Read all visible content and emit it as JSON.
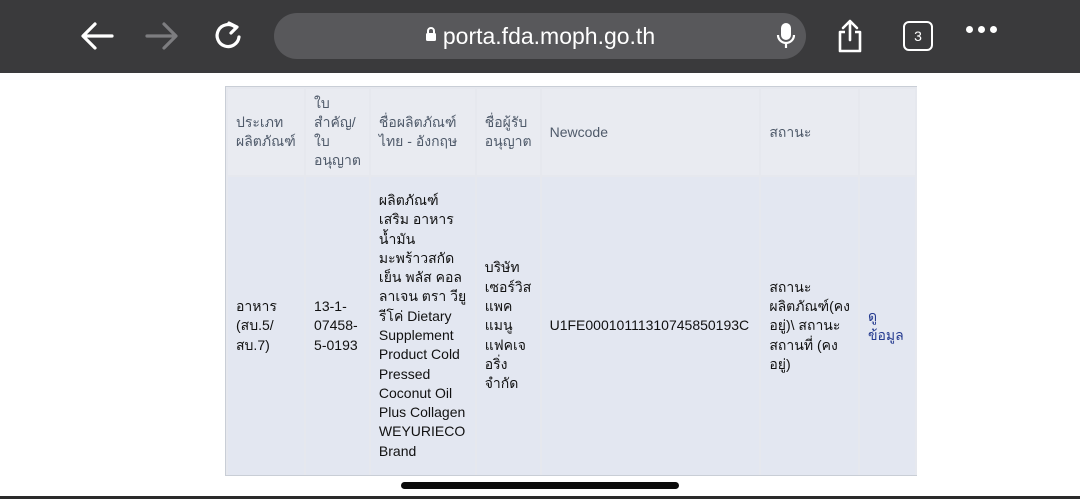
{
  "browser": {
    "url": "porta.fda.moph.go.th",
    "tab_count": "3",
    "icons": [
      "back-arrow-icon",
      "forward-arrow-icon",
      "reload-icon",
      "lock-icon",
      "microphone-icon",
      "share-icon",
      "tabs-icon",
      "more-icon"
    ]
  },
  "table": {
    "headers": [
      "ประเภท ผลิตภัณฑ์",
      "ใบ สำคัญ/ ใบ อนุญาต",
      "ชื่อผลิตภัณฑ์ ไทย - อังกฤษ",
      "ชื่อผู้รับ อนุญาต",
      "Newcode",
      "สถานะ",
      ""
    ],
    "row": {
      "type": "อาหาร (สบ.5/ สบ.7)",
      "license": "13-1- 07458- 5-0193",
      "product": "ผลิตภัณฑ์เสริม อาหาร น้ำมัน มะพร้าวสกัด เย็น พลัส คอล ลาเจน ตรา วียู รีโค่ Dietary Supplement Product Cold Pressed Coconut Oil Plus Collagen WEYURIECO Brand",
      "licensee": "บริษัท เซอร์วิส แพค แมนู แฟคเจ อริ่ง จำกัด",
      "newcode": "U1FE00010111310745850193C",
      "status": "สถานะ ผลิตภัณฑ์(คง อยู่)\\ สถานะ สถานที่ (คง อยู่)",
      "link": "ดู ข้อมูล"
    }
  }
}
